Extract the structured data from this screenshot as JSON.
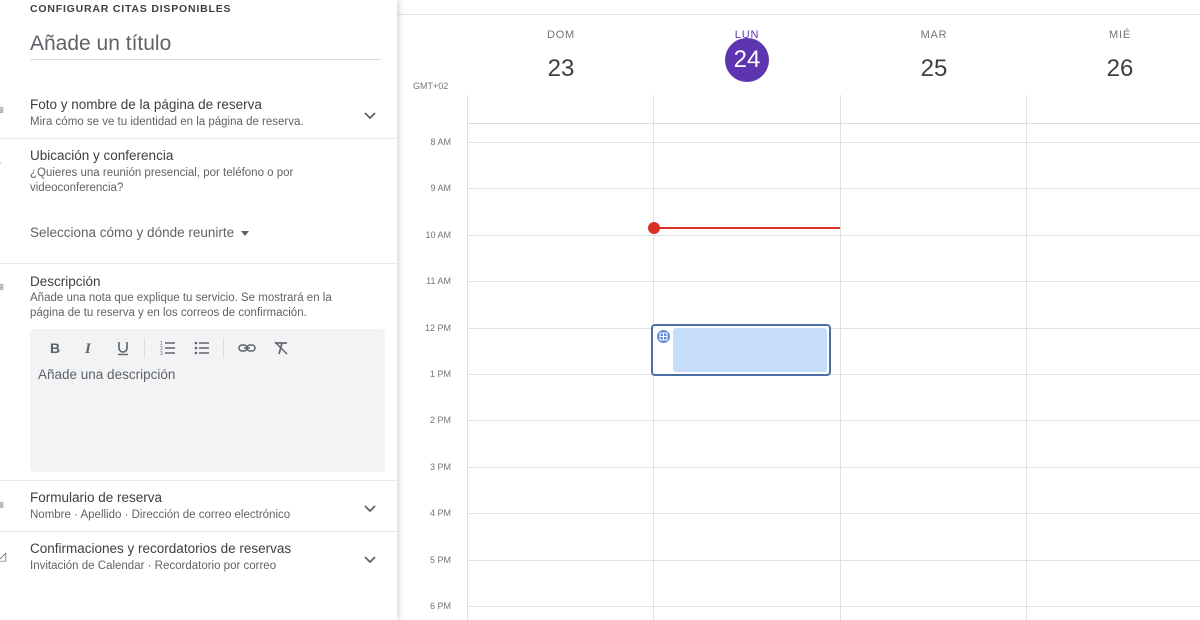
{
  "panel": {
    "header": "CONFIGURAR CITAS DISPONIBLES",
    "title_placeholder": "Añade un título",
    "booking_page": {
      "title": "Foto y nombre de la página de reserva",
      "subtitle": "Mira cómo se ve tu identidad en la página de reserva."
    },
    "location": {
      "title": "Ubicación y conferencia",
      "subtitle_line1": "¿Quieres una reunión presencial, por teléfono o por",
      "subtitle_line2": "videoconferencia?",
      "select_label": "Selecciona cómo y dónde reunirte"
    },
    "description": {
      "title": "Descripción",
      "subtitle_line1": "Añade una nota que explique tu servicio. Se mostrará en la",
      "subtitle_line2": "página de tu reserva y en los correos de confirmación.",
      "placeholder": "Añade una descripción"
    },
    "form": {
      "title": "Formulario de reserva",
      "subtitle": "Nombre · Apellido · Dirección de correo electrónico"
    },
    "confirmations": {
      "title": "Confirmaciones y recordatorios de reservas",
      "subtitle": "Invitación de Calendar · Recordatorio por correo"
    },
    "toolbar_icons": [
      "bold-icon",
      "italic-icon",
      "underline-icon",
      "numbered-list-icon",
      "bulleted-list-icon",
      "link-icon",
      "clear-format-icon"
    ]
  },
  "calendar": {
    "timezone": "GMT+02",
    "days": [
      {
        "name": "DOM",
        "number": "23",
        "today": false
      },
      {
        "name": "LUN",
        "number": "24",
        "today": true
      },
      {
        "name": "MAR",
        "number": "25",
        "today": false
      },
      {
        "name": "MIÉ",
        "number": "26",
        "today": false
      }
    ],
    "hours": [
      "8 AM",
      "9 AM",
      "10 AM",
      "11 AM",
      "12 PM",
      "1 PM",
      "2 PM",
      "3 PM",
      "4 PM",
      "5 PM",
      "6 PM"
    ],
    "today_color": "#5e35b1",
    "now_indicator_color": "#d93025",
    "event_color": "#c6dcfb"
  }
}
